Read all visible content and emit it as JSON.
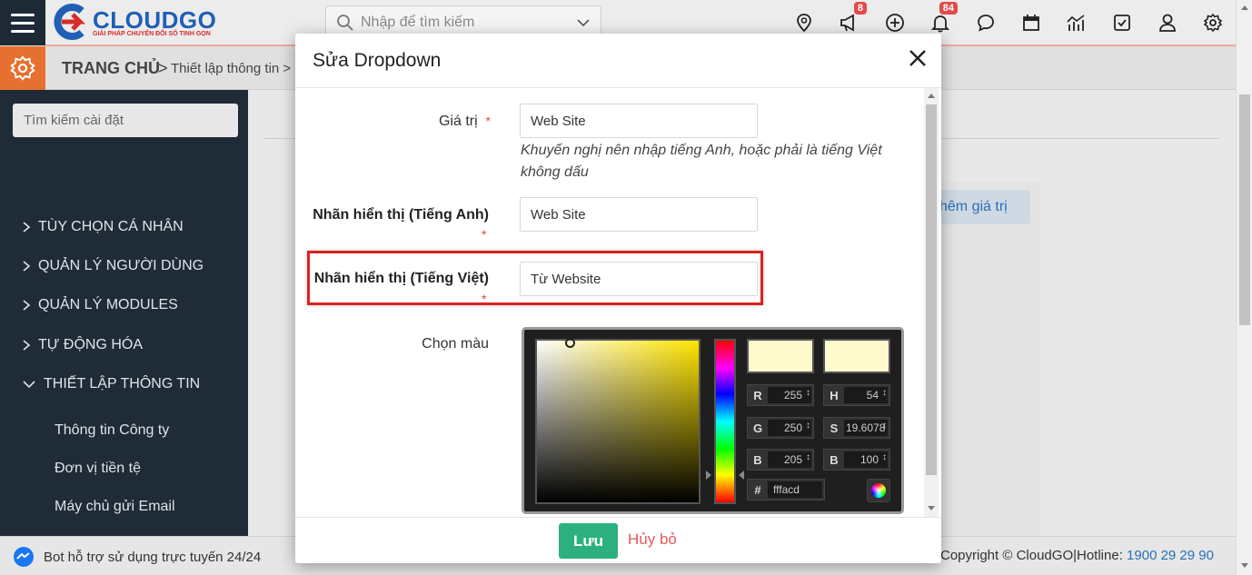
{
  "header": {
    "logo_title": "CLOUDGO",
    "logo_subtitle": "GIẢI PHÁP CHUYỂN ĐỔI SỐ TINH GỌN",
    "search_placeholder": "Nhập để tìm kiếm",
    "icons": [
      {
        "name": "location-icon",
        "badge": ""
      },
      {
        "name": "megaphone-icon",
        "badge": "8"
      },
      {
        "name": "add-circle-icon",
        "badge": ""
      },
      {
        "name": "bell-icon",
        "badge": "84"
      },
      {
        "name": "chat-icon",
        "badge": ""
      },
      {
        "name": "calendar-icon",
        "badge": ""
      },
      {
        "name": "chart-icon",
        "badge": ""
      },
      {
        "name": "checkbox-icon",
        "badge": ""
      },
      {
        "name": "user-icon",
        "badge": ""
      },
      {
        "name": "settings-icon",
        "badge": ""
      }
    ]
  },
  "breadcrumb": {
    "home": "TRANG CHỦ",
    "separator": ">",
    "current": "Thiết lập thông tin >"
  },
  "sidebar": {
    "search_placeholder": "Tìm kiếm cài đặt",
    "items": [
      {
        "label": "TÙY CHỌN CÁ NHÂN",
        "expanded": false
      },
      {
        "label": "QUẢN LÝ NGƯỜI DÙNG",
        "expanded": false
      },
      {
        "label": "QUẢN LÝ MODULES",
        "expanded": false
      },
      {
        "label": "TỰ ĐỘNG HÓA",
        "expanded": false
      },
      {
        "label": "THIẾT LẬP THÔNG TIN",
        "expanded": true
      }
    ],
    "subitems": [
      "Thông tin Công ty",
      "Đơn vị tiền tệ",
      "Máy chủ gửi Email"
    ]
  },
  "background": {
    "add_value_button": "hêm giá trị"
  },
  "footer": {
    "bot_text": "Bot hỗ trợ sử dụng trực tuyến 24/24",
    "copyright": "Copyright © CloudGO|Hotline: ",
    "hotline": "1900 29 29 90"
  },
  "modal": {
    "title": "Sửa Dropdown",
    "required_mark": "*",
    "fields": {
      "value_label": "Giá trị",
      "value": "Web Site",
      "value_hint": "Khuyến nghị nên nhập tiếng Anh, hoặc phải là tiếng Việt không dấu",
      "label_en": "Nhãn hiển thị (Tiếng Anh)",
      "value_en": "Web Site",
      "label_vi": "Nhãn hiển thị (Tiếng Việt)",
      "value_vi": "Từ Website",
      "color_label": "Chọn màu"
    },
    "color_picker": {
      "selected_color": "#fffacd",
      "original_color": "#fffacd",
      "R": "255",
      "G": "250",
      "B": "205",
      "H": "54",
      "S": "19.6078",
      "Bv": "100",
      "hex": "fffacd",
      "label_R": "R",
      "label_G": "G",
      "label_B": "B",
      "label_H": "H",
      "label_S": "S",
      "label_Bv": "B",
      "label_hex": "#"
    },
    "save_label": "Lưu",
    "cancel_label": "Hủy bỏ"
  },
  "colors": {
    "sidebar_bg": "#1f2b37",
    "accent_orange": "#e6702f",
    "save_green": "#2db07f",
    "cancel_red": "#e25a5a",
    "highlight_red": "#d9231f",
    "brand_blue": "#1f5fb5"
  }
}
